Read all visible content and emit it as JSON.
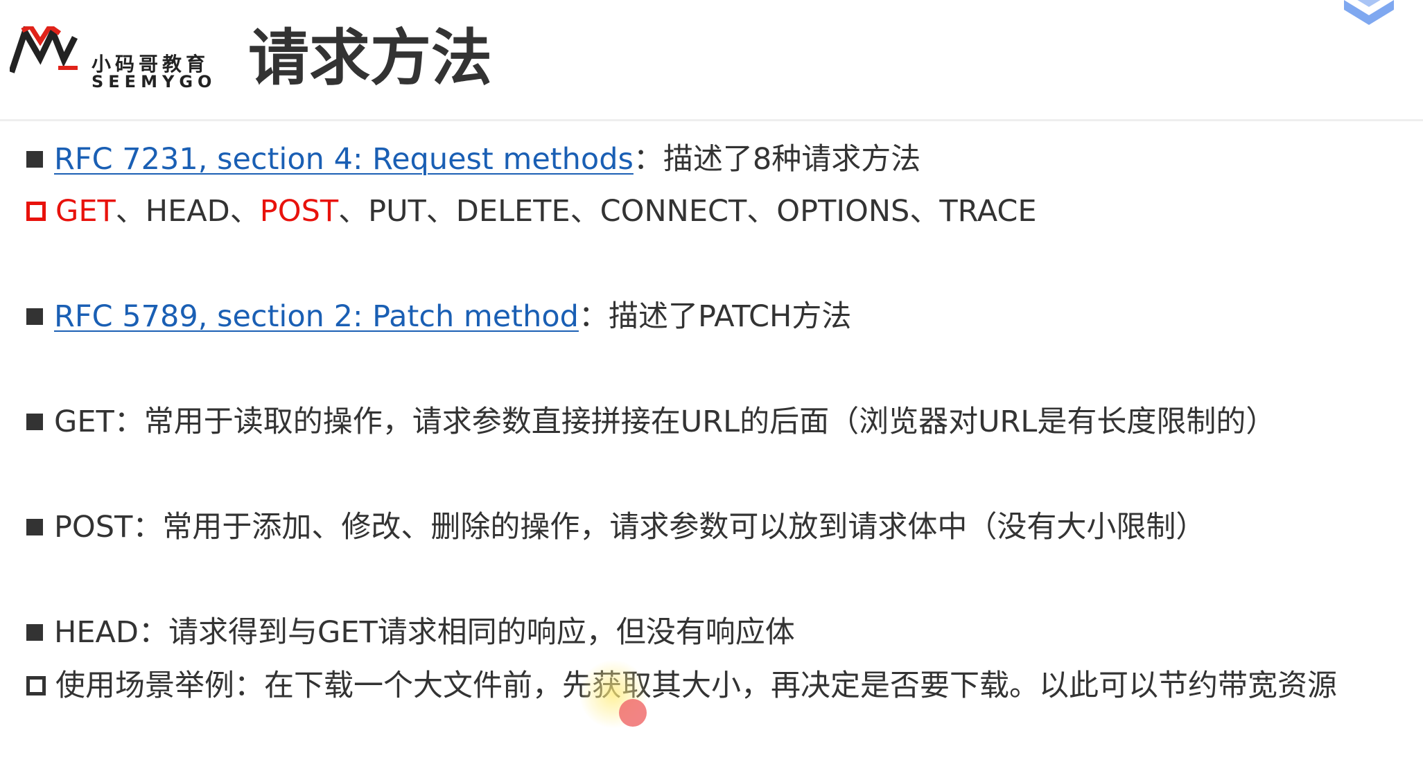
{
  "header": {
    "logo_cn": "小码哥教育",
    "logo_en": "SEEMYGO",
    "title": "请求方法"
  },
  "lines": {
    "rfc7231_link": "RFC 7231, section 4: Request methods",
    "rfc7231_desc": "：描述了8种请求方法",
    "methods_get": "GET",
    "methods_sep1": "、HEAD、",
    "methods_post": "POST",
    "methods_rest": "、PUT、DELETE、CONNECT、OPTIONS、TRACE",
    "rfc5789_link": "RFC 5789, section 2: Patch method",
    "rfc5789_desc": "：描述了PATCH方法",
    "get_desc": "GET：常用于读取的操作，请求参数直接拼接在URL的后面（浏览器对URL是有长度限制的）",
    "post_desc": "POST：常用于添加、修改、删除的操作，请求参数可以放到请求体中（没有大小限制）",
    "head_desc": "HEAD：请求得到与GET请求相同的响应，但没有响应体",
    "head_example": "使用场景举例：在下载一个大文件前，先获取其大小，再决定是否要下载。以此可以节约带宽资源"
  },
  "colors": {
    "text": "#333333",
    "link": "#1a5fb4",
    "highlight_red": "#e8120c",
    "logo_red": "#e0231a"
  },
  "icons": {
    "logo": "seemygo-m-logo",
    "corner": "layers-badge-icon"
  }
}
